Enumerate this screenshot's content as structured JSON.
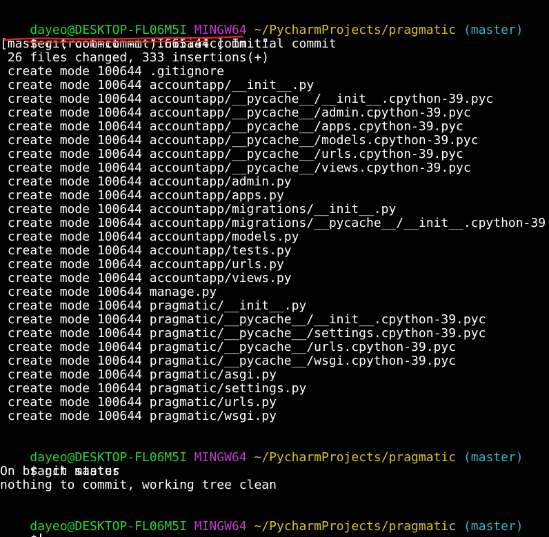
{
  "prompt": {
    "user_host": "dayeo@DESKTOP-FL06M5I",
    "system": "MINGW64",
    "path": "~/PycharmProjects/pragmatic",
    "branch": "(master)",
    "symbol": "$"
  },
  "command1": "git commit -m \"Initial commit\"",
  "commit_output": [
    "[master (root-commit) 665a44c] Initial commit",
    " 26 files changed, 333 insertions(+)"
  ],
  "created_files": [
    " create mode 100644 .gitignore",
    " create mode 100644 accountapp/__init__.py",
    " create mode 100644 accountapp/__pycache__/__init__.cpython-39.pyc",
    " create mode 100644 accountapp/__pycache__/admin.cpython-39.pyc",
    " create mode 100644 accountapp/__pycache__/apps.cpython-39.pyc",
    " create mode 100644 accountapp/__pycache__/models.cpython-39.pyc",
    " create mode 100644 accountapp/__pycache__/urls.cpython-39.pyc",
    " create mode 100644 accountapp/__pycache__/views.cpython-39.pyc",
    " create mode 100644 accountapp/admin.py",
    " create mode 100644 accountapp/apps.py",
    " create mode 100644 accountapp/migrations/__init__.py",
    " create mode 100644 accountapp/migrations/__pycache__/__init__.cpython-39",
    " create mode 100644 accountapp/models.py",
    " create mode 100644 accountapp/tests.py",
    " create mode 100644 accountapp/urls.py",
    " create mode 100644 accountapp/views.py",
    " create mode 100644 manage.py",
    " create mode 100644 pragmatic/__init__.py",
    " create mode 100644 pragmatic/__pycache__/__init__.cpython-39.pyc",
    " create mode 100644 pragmatic/__pycache__/settings.cpython-39.pyc",
    " create mode 100644 pragmatic/__pycache__/urls.cpython-39.pyc",
    " create mode 100644 pragmatic/__pycache__/wsgi.cpython-39.pyc",
    " create mode 100644 pragmatic/asgi.py",
    " create mode 100644 pragmatic/settings.py",
    " create mode 100644 pragmatic/urls.py",
    " create mode 100644 pragmatic/wsgi.py"
  ],
  "command2": "git status",
  "status_output": [
    "On branch master",
    "nothing to commit, working tree clean"
  ],
  "colors": {
    "background": "#000000",
    "user_host": "#23d63a",
    "system": "#c13ad1",
    "path": "#d4c51e",
    "branch": "#2fb7c8",
    "text": "#ffffff",
    "annotation": "#e0241f"
  }
}
